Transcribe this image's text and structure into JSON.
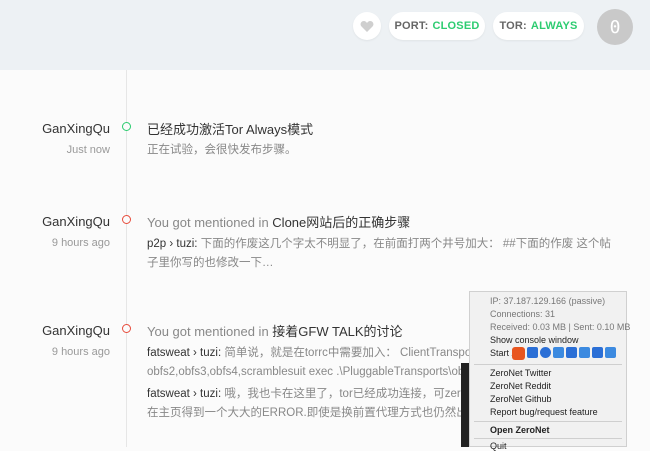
{
  "header": {
    "port_label": "PORT:",
    "port_value": "CLOSED",
    "tor_label": "TOR:",
    "tor_value": "ALWAYS",
    "avatar_text": "0"
  },
  "feed": [
    {
      "user": "GanXingQu",
      "time": "Just now",
      "title_prefix": "",
      "title": "已经成功激活Tor Always模式",
      "body_lines": [
        "正在试验，会很快发布步骤。"
      ]
    },
    {
      "user": "GanXingQu",
      "time": "9 hours ago",
      "title_prefix": "You got mentioned in",
      "title": "Clone网站后的正确步骤",
      "who": "p2p",
      "sep": "› tuzi:",
      "body_lines": [
        "下面的作废这几个字太不明显了，在前面打两个井号加大： ##下面的作废 这个帖",
        "子里你写的也修改一下…"
      ]
    },
    {
      "user": "GanXingQu",
      "time": "9 hours ago",
      "title_prefix": "You got mentioned in",
      "title": "接着GFW TALK的讨论",
      "comment1_who": "fatsweat",
      "comment1_sep": "› tuzi:",
      "comment1_lines": [
        "简单说，就是在torrc中需要加入： ClientTransport",
        "obfs2,obfs3,obfs4,scramblesuit exec .\\PluggableTransports\\obfs"
      ],
      "comment2_who": "fatsweat",
      "comment2_sep": "› tuzi:",
      "comment2_lines": [
        "哦，我也卡在这里了，tor已经成功连接，可zero",
        "在主页得到一个大大的ERROR.即使是换前置代理方式也仍然出错"
      ]
    }
  ],
  "tray_menu": {
    "ip": "IP: 37.187.129.166 (passive)",
    "connections": "Connections: 31",
    "traffic": "Received: 0.03 MB | Sent: 0.10 MB",
    "show_console": "Show console window",
    "start": "Start Z",
    "twitter": "ZeroNet Twitter",
    "reddit": "ZeroNet Reddit",
    "github": "ZeroNet Github",
    "report": "Report bug/request feature",
    "open": "Open ZeroNet",
    "quit": "Quit"
  }
}
